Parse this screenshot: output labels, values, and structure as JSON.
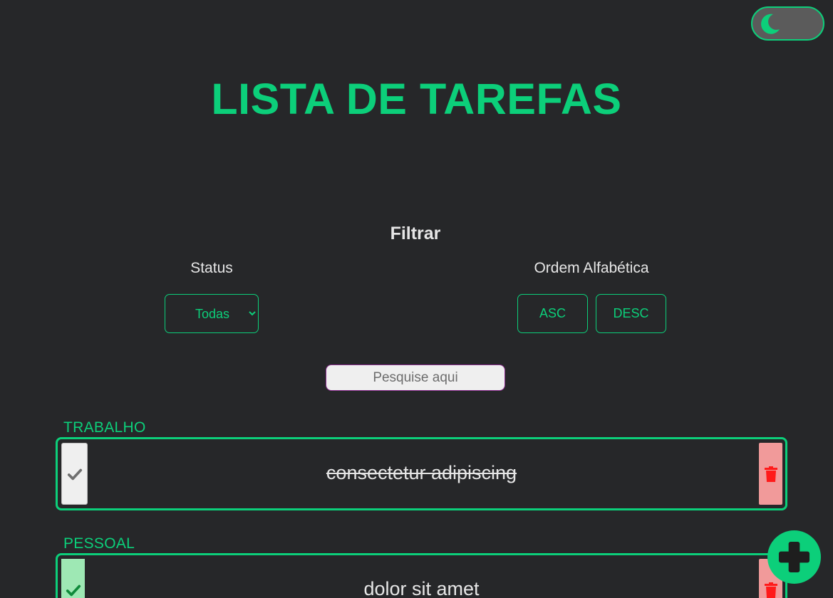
{
  "header": {
    "title": "LISTA DE TAREFAS",
    "theme_toggle_icon": "moon-icon"
  },
  "filters": {
    "heading": "Filtrar",
    "status_label": "Status",
    "status_selected": "Todas",
    "order_label": "Ordem Alfabética",
    "asc_label": "ASC",
    "desc_label": "DESC"
  },
  "search": {
    "placeholder": "Pesquise aqui"
  },
  "tasks": [
    {
      "category": "TRABALHO",
      "text": "consectetur adipiscing",
      "done": true
    },
    {
      "category": "PESSOAL",
      "text": "dolor sit amet",
      "done": false
    }
  ],
  "colors": {
    "accent": "#0ccf7a",
    "background": "#262729",
    "delete": "#f19a9a"
  },
  "fab": {
    "icon": "plus-icon"
  }
}
